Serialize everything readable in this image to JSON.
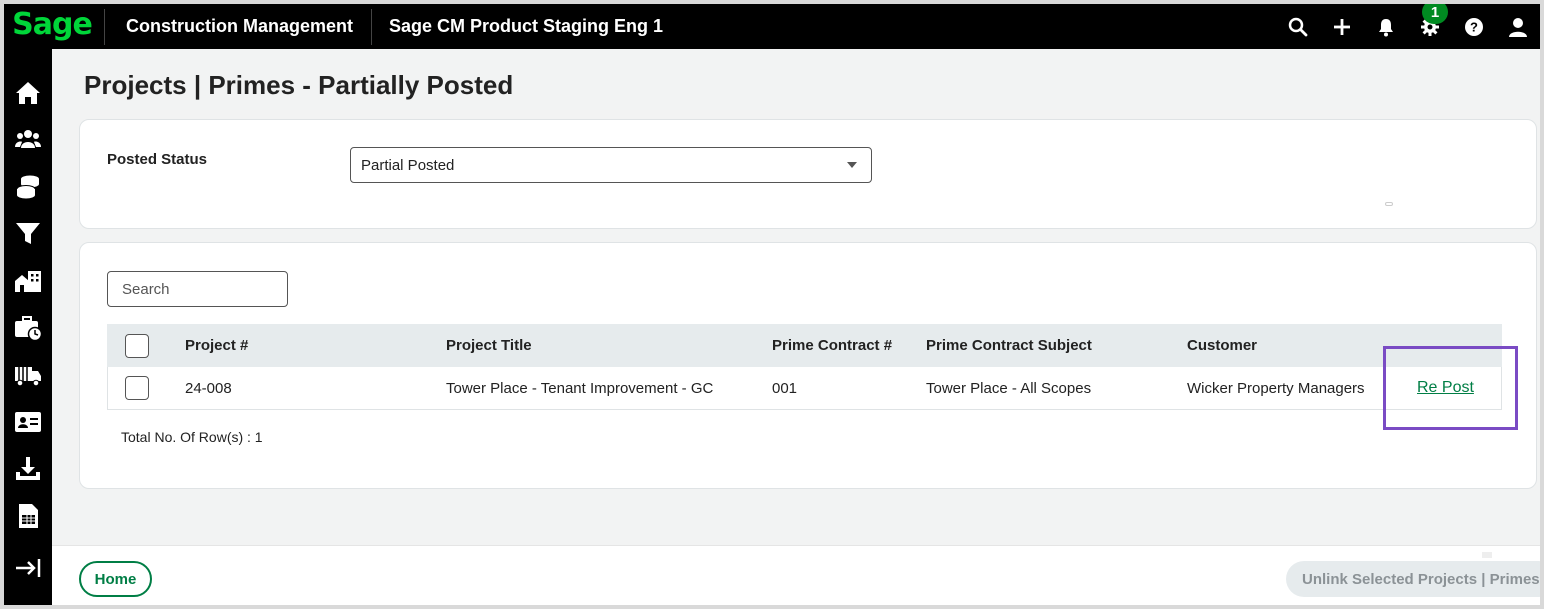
{
  "brand": {
    "logo_text": "Sage",
    "accent": "#00d639"
  },
  "topbar": {
    "app_name": "Construction Management",
    "company": "Sage CM Product Staging Eng 1",
    "icons": [
      "search-icon",
      "plus-icon",
      "bell-icon",
      "gear-icon",
      "help-icon",
      "user-icon"
    ],
    "notification_count": "1",
    "help_label": "?"
  },
  "sidebar": {
    "items": [
      "home-icon",
      "people-icon",
      "coins-icon",
      "filter-icon",
      "buildings-icon",
      "briefcase-clock-icon",
      "truck-icon",
      "id-card-icon",
      "download-icon",
      "spreadsheet-icon",
      "expand-icon"
    ]
  },
  "page": {
    "title": "Projects | Primes - Partially Posted"
  },
  "filter": {
    "label": "Posted Status",
    "selected": "Partial Posted"
  },
  "search": {
    "placeholder": "Search"
  },
  "table": {
    "headers": [
      "Project #",
      "Project Title",
      "Prime Contract #",
      "Prime Contract Subject",
      "Customer"
    ],
    "rows": [
      {
        "project_num": "24-008",
        "project_title": "Tower Place - Tenant Improvement - GC",
        "prime_contract_num": "001",
        "prime_contract_subject": "Tower Place - All Scopes",
        "customer": "Wicker Property Managers",
        "action": "Re Post"
      }
    ],
    "total": "Total No. Of Row(s) : 1"
  },
  "footer": {
    "home_label": "Home",
    "unlink_label": "Unlink Selected Projects | Primes"
  },
  "colors": {
    "highlight": "#7a4bc4",
    "link": "#007e45"
  }
}
